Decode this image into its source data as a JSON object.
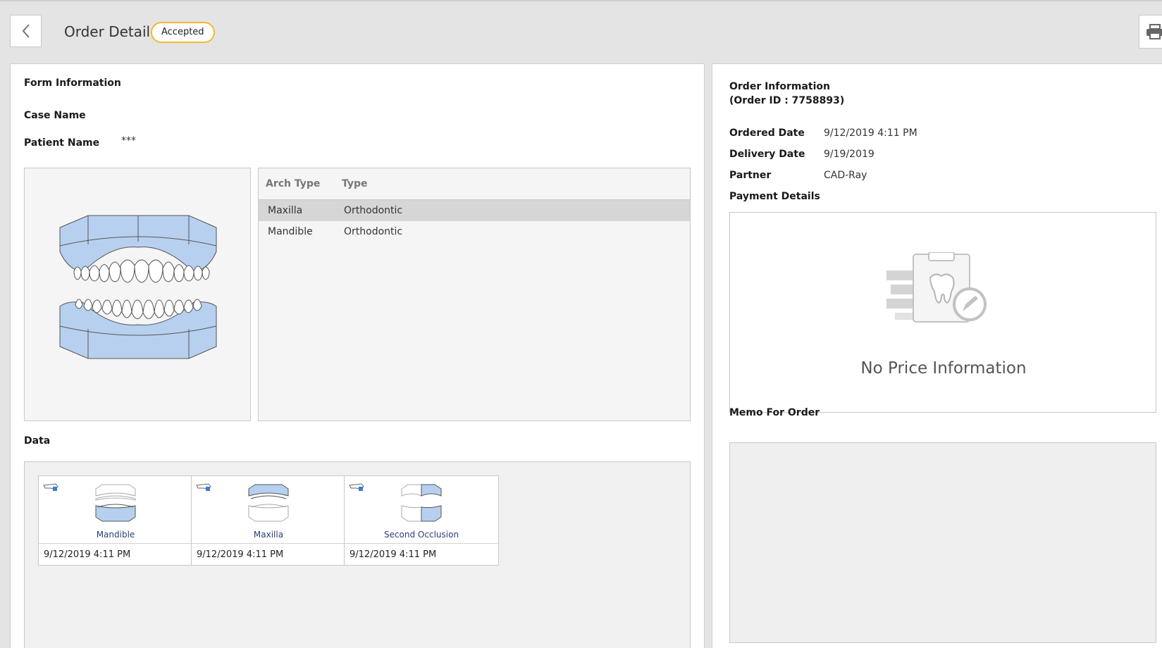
{
  "header": {
    "title": "Order Detail",
    "status": "Accepted",
    "status_color": "#f2b92e"
  },
  "form": {
    "section_title": "Form Information",
    "case_name_label": "Case Name",
    "case_name_value": "",
    "patient_name_label": "Patient Name",
    "patient_name_value": "***",
    "arch_table": {
      "headers": [
        "Arch Type",
        "Type"
      ],
      "rows": [
        {
          "arch": "Maxilla",
          "type": "Orthodontic",
          "selected": true
        },
        {
          "arch": "Mandible",
          "type": "Orthodontic",
          "selected": false
        }
      ]
    },
    "data_title": "Data",
    "data_items": [
      {
        "label": "Mandible",
        "date": "9/12/2019 4:11 PM",
        "icon": "mandible-scan-icon"
      },
      {
        "label": "Maxilla",
        "date": "9/12/2019 4:11 PM",
        "icon": "maxilla-scan-icon"
      },
      {
        "label": "Second Occlusion",
        "date": "9/12/2019 4:11 PM",
        "icon": "occlusion-scan-icon"
      }
    ]
  },
  "order": {
    "title_line1": "Order Information",
    "title_line2": "(Order ID : 7758893)",
    "ordered_date_label": "Ordered Date",
    "ordered_date_value": "9/12/2019 4:11 PM",
    "delivery_date_label": "Delivery Date",
    "delivery_date_value": "9/19/2019",
    "partner_label": "Partner",
    "partner_value": "CAD-Ray",
    "payment_title": "Payment Details",
    "no_price_text": "No Price Information",
    "memo_title": "Memo For Order",
    "memo_value": ""
  },
  "colors": {
    "arch_fill": "#b8d0ef",
    "arch_stroke": "#555555",
    "label_blue": "#2a3d7a"
  }
}
